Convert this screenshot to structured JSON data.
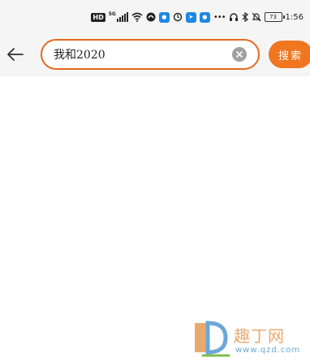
{
  "status_bar": {
    "network_badge": "HD",
    "network_type": "5G",
    "battery_level": "73",
    "time": "1:56",
    "icons": [
      "hd-icon",
      "signal-icon",
      "wifi-icon",
      "app-icon",
      "notification-icon",
      "sync-icon",
      "location-icon",
      "notification-icon",
      "dots-icon",
      "headphones-icon",
      "bluetooth-icon",
      "mute-icon",
      "battery-icon"
    ]
  },
  "header": {
    "search_value": "我和2020",
    "search_button_label": "搜索"
  },
  "watermark": {
    "brand": "趣丁网",
    "url": "www.qzd.com"
  },
  "colors": {
    "accent": "#f0761f",
    "search_border": "#e66a1e",
    "background": "#ffffff",
    "header_bg": "#f5f5f5"
  }
}
